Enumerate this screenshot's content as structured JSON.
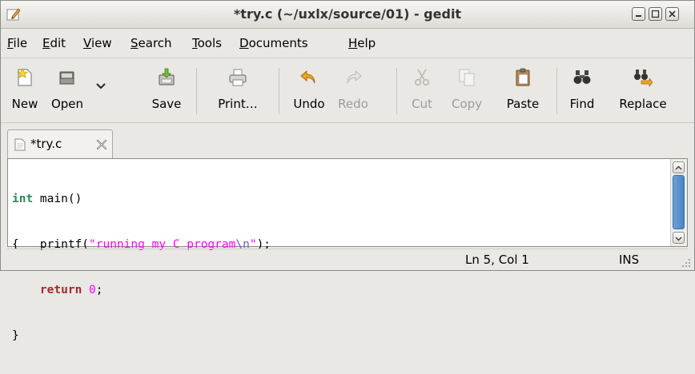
{
  "window": {
    "title": "*try.c (~/uxlx/source/01) - gedit",
    "controls": [
      "minimize",
      "maximize",
      "close"
    ]
  },
  "menubar": {
    "items": [
      {
        "mnemonic": "F",
        "rest": "ile"
      },
      {
        "mnemonic": "E",
        "rest": "dit"
      },
      {
        "mnemonic": "V",
        "rest": "iew"
      },
      {
        "mnemonic": "S",
        "rest": "earch"
      },
      {
        "mnemonic": "T",
        "rest": "ools"
      },
      {
        "mnemonic": "D",
        "rest": "ocuments"
      },
      {
        "mnemonic": "H",
        "rest": "elp"
      }
    ]
  },
  "toolbar": {
    "new": "New",
    "open": "Open",
    "save": "Save",
    "print": "Print…",
    "undo": "Undo",
    "redo": "Redo",
    "cut": "Cut",
    "copy": "Copy",
    "paste": "Paste",
    "find": "Find",
    "replace": "Replace",
    "disabled": [
      "Redo",
      "Cut",
      "Copy"
    ]
  },
  "tab": {
    "label": "*try.c"
  },
  "editor": {
    "lines": [
      {
        "kw": "int",
        "rest": " main()"
      },
      {
        "pre": "{   printf(",
        "str": "\"running my C program",
        "esc": "\\n",
        "str_end": "\"",
        "post": ");"
      },
      {
        "indent": "    ",
        "kw": "return",
        "sp": " ",
        "num": "0",
        "post": ";"
      },
      {
        "text": "}"
      }
    ]
  },
  "statusbar": {
    "position": "Ln 5, Col 1",
    "mode": "INS"
  },
  "colors": {
    "keyword": "#2e8b57",
    "return_keyword": "#a52a2a",
    "string": "#ff00ff",
    "escape": "#6a5acd",
    "scrollbar_thumb": "#4b84c4"
  }
}
